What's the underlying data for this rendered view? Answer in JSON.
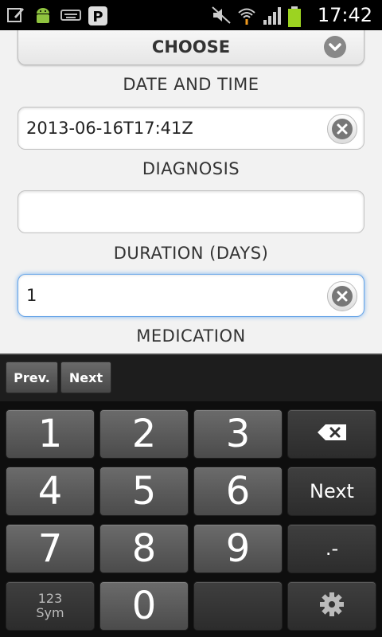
{
  "status_bar": {
    "time": "17:42",
    "icons": [
      "edit-icon",
      "android-icon",
      "keyboard-icon",
      "pinterest-icon",
      "mute-icon",
      "wifi-icon",
      "signal-icon",
      "battery-icon"
    ]
  },
  "form": {
    "choose_label": "CHOOSE",
    "date_time": {
      "label": "DATE AND TIME",
      "value": "2013-06-16T17:41Z"
    },
    "diagnosis": {
      "label": "DIAGNOSIS",
      "value": ""
    },
    "duration": {
      "label": "DURATION (DAYS)",
      "value": "1"
    },
    "medication": {
      "label": "MEDICATION"
    }
  },
  "keyboard": {
    "toolbar": {
      "prev": "Prev.",
      "next": "Next"
    },
    "keys": {
      "k1": "1",
      "k2": "2",
      "k3": "3",
      "k4": "4",
      "k5": "5",
      "k6": "6",
      "k7": "7",
      "k8": "8",
      "k9": "9",
      "k0": "0",
      "next": "Next",
      "dot_dash": ".-",
      "sym_top": "123",
      "sym_bottom": "Sym"
    }
  },
  "colors": {
    "background": "#f2f2f2",
    "focus_border": "#6aa6e8",
    "keyboard_bg": "#0e0e0e"
  }
}
